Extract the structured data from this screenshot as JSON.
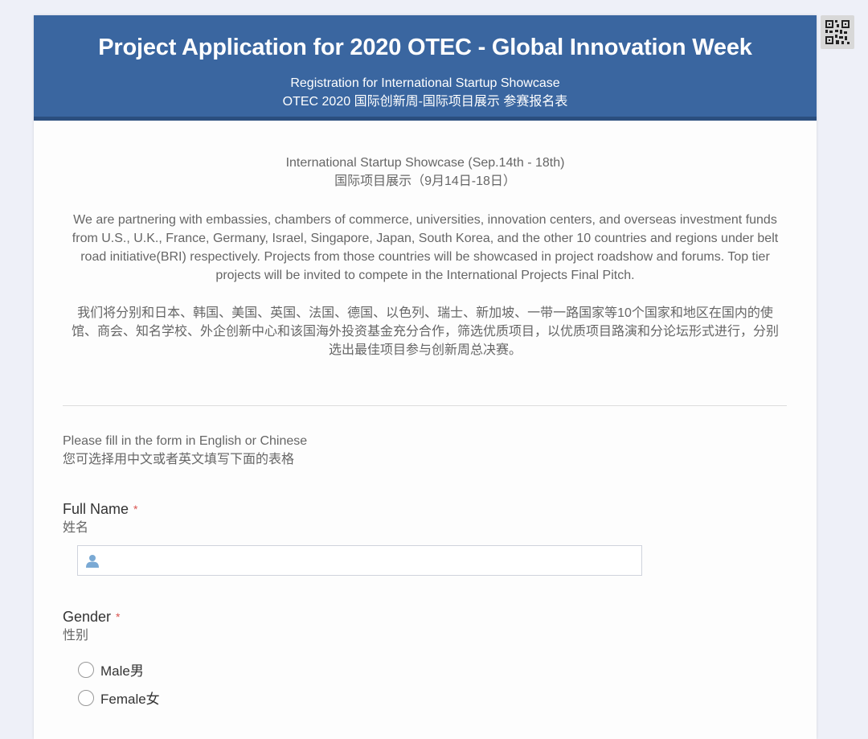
{
  "header": {
    "title": "Project Application for 2020 OTEC - Global Innovation Week",
    "subtitle_en": "Registration for International Startup Showcase",
    "subtitle_cn": "OTEC 2020 国际创新周-国际项目展示 参赛报名表"
  },
  "intro": {
    "section_title_en": "International Startup Showcase (Sep.14th - 18th)",
    "section_title_cn": "国际项目展示（9月14日-18日）",
    "paragraph_en": "We are partnering with embassies, chambers of commerce, universities, innovation centers, and overseas investment funds from U.S., U.K., France, Germany, Israel, Singapore, Japan, South Korea, and the other 10 countries and regions under belt road initiative(BRI) respectively. Projects from those countries will be showcased in project roadshow and forums. Top tier projects will be invited to compete in the International Projects Final Pitch.",
    "paragraph_cn": "我们将分别和日本、韩国、美国、英国、法国、德国、以色列、瑞士、新加坡、一带一路国家等10个国家和地区在国内的使馆、商会、知名学校、外企创新中心和该国海外投资基金充分合作，筛选优质项目，以优质项目路演和分论坛形式进行，分别选出最佳项目参与创新周总决赛。"
  },
  "instructions": {
    "en": "Please fill in the form in English or Chinese",
    "cn": "您可选择用中文或者英文填写下面的表格"
  },
  "fields": {
    "full_name": {
      "label": "Full Name",
      "required_mark": "*",
      "sublabel": "姓名",
      "value": "",
      "placeholder": ""
    },
    "gender": {
      "label": "Gender",
      "required_mark": "*",
      "sublabel": "性别",
      "options": [
        "Male男",
        "Female女"
      ]
    }
  },
  "colors": {
    "header_bg": "#3a66a0",
    "header_border": "#2b4e7e",
    "required": "#d9534f",
    "icon_blue": "#7aa9d4"
  },
  "icons": {
    "qr": "qr-code-icon",
    "user": "user-icon"
  }
}
